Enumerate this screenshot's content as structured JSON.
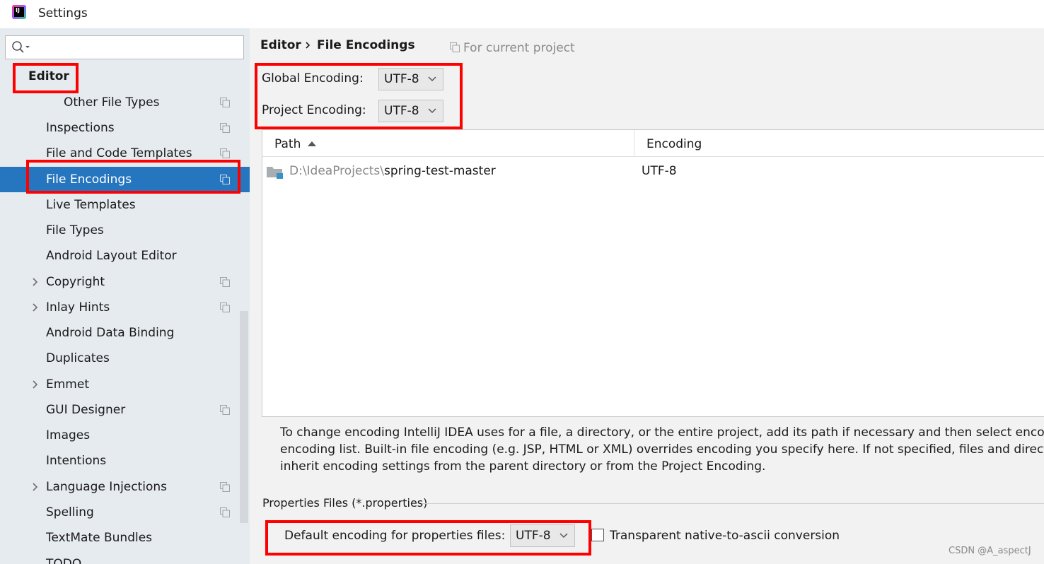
{
  "window": {
    "title": "Settings"
  },
  "sidebar": {
    "search": {
      "placeholder": ""
    },
    "editor_label": "Editor",
    "items": [
      {
        "label": "Other File Types"
      },
      {
        "label": "Inspections"
      },
      {
        "label": "File and Code Templates"
      },
      {
        "label": "File Encodings"
      },
      {
        "label": "Live Templates"
      },
      {
        "label": "File Types"
      },
      {
        "label": "Android Layout Editor"
      },
      {
        "label": "Copyright"
      },
      {
        "label": "Inlay Hints"
      },
      {
        "label": "Android Data Binding"
      },
      {
        "label": "Duplicates"
      },
      {
        "label": "Emmet"
      },
      {
        "label": "GUI Designer"
      },
      {
        "label": "Images"
      },
      {
        "label": "Intentions"
      },
      {
        "label": "Language Injections"
      },
      {
        "label": "Spelling"
      },
      {
        "label": "TextMate Bundles"
      },
      {
        "label": "TODO"
      }
    ]
  },
  "breadcrumb": {
    "parent": "Editor",
    "current": "File Encodings"
  },
  "scope_label": "For current project",
  "encodings": {
    "global_label": "Global Encoding:",
    "global_value": "UTF-8",
    "project_label": "Project Encoding:",
    "project_value": "UTF-8"
  },
  "table": {
    "columns": [
      "Path",
      "Encoding"
    ],
    "rows": [
      {
        "path_prefix": "D:\\IdeaProjects\\",
        "path_name": "spring-test-master",
        "encoding": "UTF-8"
      }
    ]
  },
  "help_text": [
    "To change encoding IntelliJ IDEA uses for a file, a directory, or the entire project, add its path if necessary and then select encoding from the",
    "encoding list. Built-in file encoding (e.g. JSP, HTML or XML) overrides encoding you specify here. If not specified, files and directories",
    "inherit encoding settings from the parent directory or from the Project Encoding."
  ],
  "properties": {
    "section_title": "Properties Files (*.properties)",
    "default_label": "Default encoding for properties files:",
    "default_value": "UTF-8",
    "transparent_label": "Transparent native-to-ascii conversion",
    "transparent_checked": false
  },
  "watermark": "CSDN @A_aspectJ",
  "colors": {
    "selection": "#2675bf",
    "highlight_box": "#ff0000",
    "sidebar_bg": "#e6ebf0"
  }
}
